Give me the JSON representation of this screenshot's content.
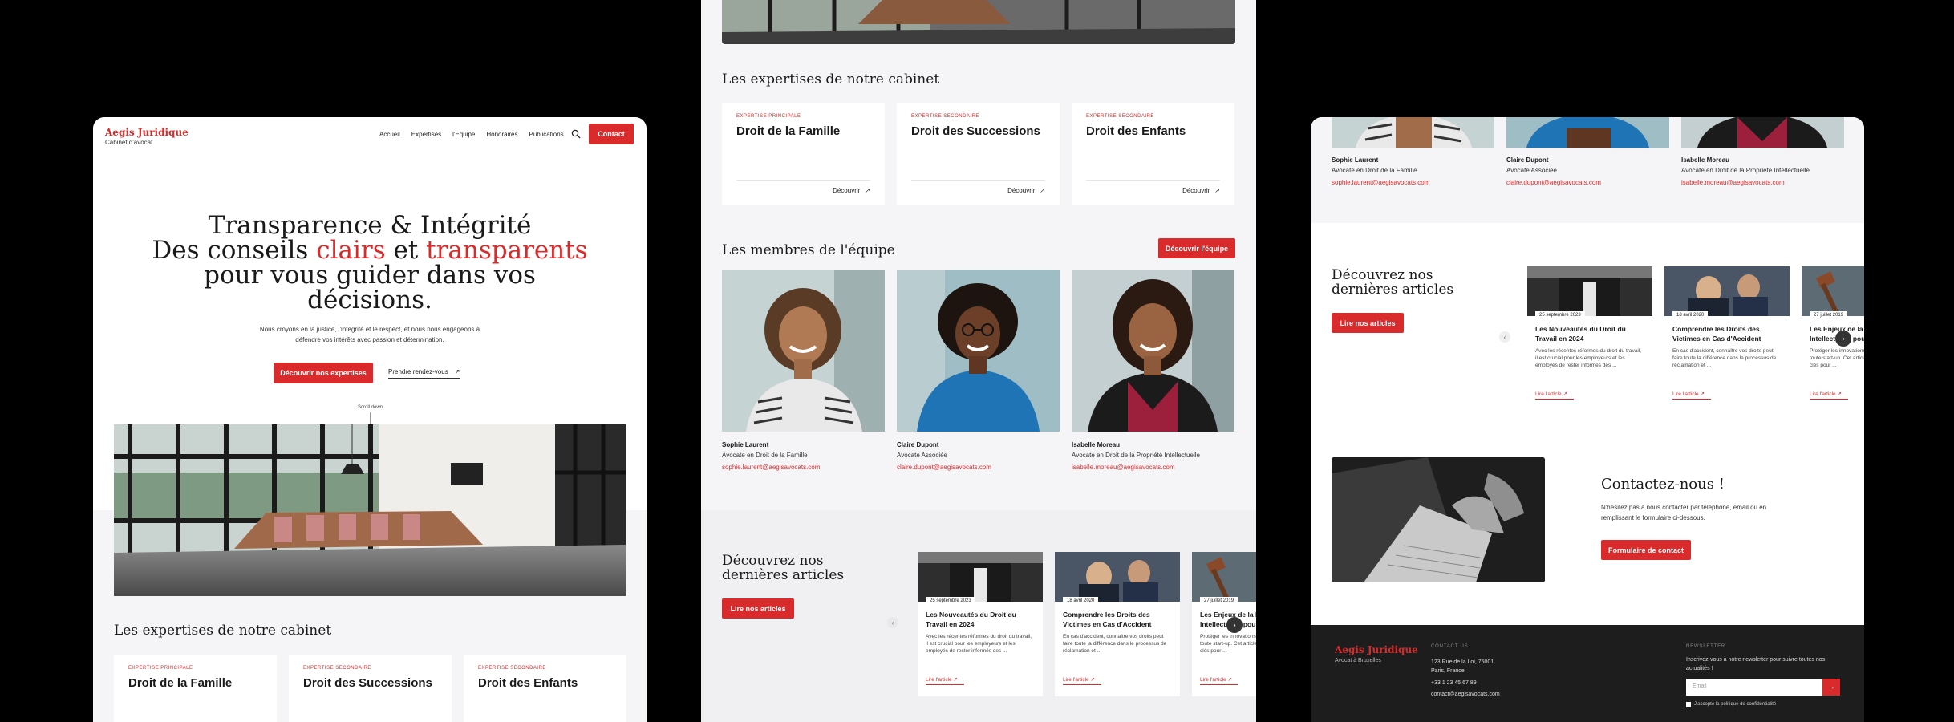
{
  "brand": {
    "name": "Aegis Juridique",
    "tagline": "Cabinet d'avocat"
  },
  "nav": {
    "items": [
      "Accueil",
      "Expertises",
      "l'Equipe",
      "Honoraires",
      "Publications"
    ],
    "contact": "Contact"
  },
  "hero": {
    "line1": "Transparence & Intégrité",
    "line2a": "Des conseils ",
    "line2b": "clairs",
    "line2c": " et ",
    "line2d": "transparents",
    "line3": "pour vous guider dans vos",
    "line4": "décisions.",
    "desc": "Nous croyons en la justice, l'intégrité et le respect, et nous nous engageons à défendre vos intérêts avec passion et détermination.",
    "btn_primary": "Découvrir nos expertises",
    "btn_secondary": "Prendre rendez-vous",
    "scroll": "Scroll down"
  },
  "expertises": {
    "title": "Les expertises de notre cabinet",
    "cards": [
      {
        "tag": "EXPERTISE PRINCIPALE",
        "title": "Droit de la Famille",
        "link": "Découvrir"
      },
      {
        "tag": "EXPERTISE SECONDAIRE",
        "title": "Droit des Successions",
        "link": "Découvrir"
      },
      {
        "tag": "EXPERTISE SECONDAIRE",
        "title": "Droit des Enfants",
        "link": "Découvrir"
      }
    ]
  },
  "team": {
    "title": "Les membres de l'équipe",
    "button": "Découvrir l'équipe",
    "members": [
      {
        "name": "Sophie Laurent",
        "role": "Avocate en Droit de la Famille",
        "email": "sophie.laurent@aegisavocats.com"
      },
      {
        "name": "Claire Dupont",
        "role": "Avocate Associée",
        "email": "claire.dupont@aegisavocats.com"
      },
      {
        "name": "Isabelle Moreau",
        "role": "Avocate en Droit de la Propriété Intellectuelle",
        "email": "isabelle.moreau@aegisavocats.com"
      }
    ]
  },
  "articles": {
    "title_line1": "Découvrez nos",
    "title_line2": "dernières articles",
    "button": "Lire nos articles",
    "items": [
      {
        "date": "25 septembre 2023",
        "title": "Les Nouveautés du Droit du Travail en 2024",
        "excerpt": "Avec les récentes réformes du droit du travail, il est crucial pour les employeurs et les employés de rester informés des ...",
        "link": "Lire l'article"
      },
      {
        "date": "18 avril 2020",
        "title": "Comprendre les Droits des Victimes en Cas d'Accident",
        "excerpt": "En cas d'accident, connaître vos droits peut faire toute la différence dans le processus de réclamation et ...",
        "link": "Lire l'article"
      },
      {
        "date": "27 juillet 2019",
        "title": "Les Enjeux de la Propriété Intellectuelle pour",
        "excerpt": "Protéger les innovations est essentiel pour toute start-up. Cet article explore les stratégies clés pour ...",
        "link": "Lire l'article"
      }
    ]
  },
  "contact": {
    "title": "Contactez-nous !",
    "desc": "N'hésitez pas à nous contacter par téléphone, email ou en remplissant le formulaire ci-dessous.",
    "button": "Formulaire de contact"
  },
  "footer": {
    "brand": "Aegis Juridique",
    "sub": "Avocat à Bruxelles",
    "contact_heading": "CONTACT US",
    "address1": "123 Rue de la Loi, 75001",
    "address2": "Paris, France",
    "phone": "+33 1 23 45 67 89",
    "email": "contact@aegisavocats.com",
    "newsletter_heading": "NEWSLETTER",
    "newsletter_desc": "Inscrivez-vous à notre newsletter pour suivre toutes nos actualités !",
    "email_placeholder": "Email",
    "consent": "J'accepte la politique de confidentialité"
  },
  "colors": {
    "accent": "#d92b2b",
    "background": "#000000",
    "footer": "#1d1d1d"
  }
}
